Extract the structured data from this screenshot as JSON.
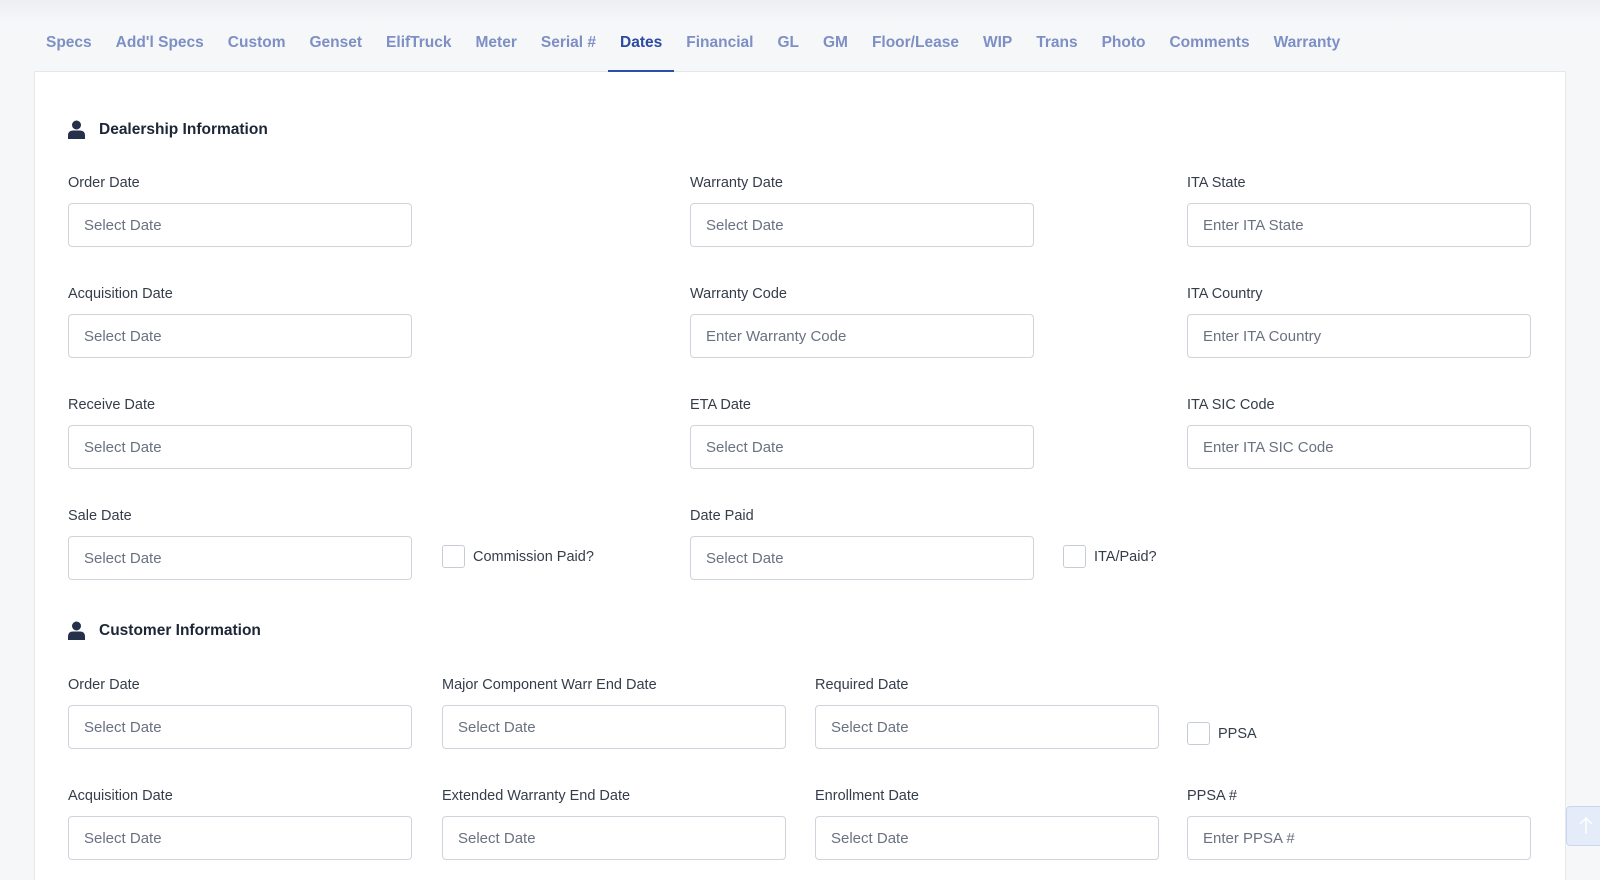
{
  "tabs": [
    {
      "label": "Specs"
    },
    {
      "label": "Add'l Specs"
    },
    {
      "label": "Custom"
    },
    {
      "label": "Genset"
    },
    {
      "label": "ElifTruck"
    },
    {
      "label": "Meter"
    },
    {
      "label": "Serial #"
    },
    {
      "label": "Dates"
    },
    {
      "label": "Financial"
    },
    {
      "label": "GL"
    },
    {
      "label": "GM"
    },
    {
      "label": "Floor/Lease"
    },
    {
      "label": "WIP"
    },
    {
      "label": "Trans"
    },
    {
      "label": "Photo"
    },
    {
      "label": "Comments"
    },
    {
      "label": "Warranty"
    }
  ],
  "active_tab": "Dates",
  "dealership": {
    "title": "Dealership Information",
    "order_date": {
      "label": "Order Date",
      "placeholder": "Select Date"
    },
    "acquisition_date": {
      "label": "Acquisition Date",
      "placeholder": "Select Date"
    },
    "receive_date": {
      "label": "Receive Date",
      "placeholder": "Select Date"
    },
    "sale_date": {
      "label": "Sale Date",
      "placeholder": "Select Date"
    },
    "commission_paid": {
      "label": "Commission Paid?",
      "checked": false
    },
    "warranty_date": {
      "label": "Warranty Date",
      "placeholder": "Select Date"
    },
    "warranty_code": {
      "label": "Warranty Code",
      "placeholder": "Enter Warranty Code"
    },
    "eta_date": {
      "label": "ETA Date",
      "placeholder": "Select Date"
    },
    "date_paid": {
      "label": "Date Paid",
      "placeholder": "Select Date"
    },
    "ita_paid": {
      "label": "ITA/Paid?",
      "checked": false
    },
    "ita_state": {
      "label": "ITA State",
      "placeholder": "Enter ITA State"
    },
    "ita_country": {
      "label": "ITA Country",
      "placeholder": "Enter ITA Country"
    },
    "ita_sic_code": {
      "label": "ITA SIC Code",
      "placeholder": "Enter ITA SIC Code"
    }
  },
  "customer": {
    "title": "Customer Information",
    "order_date": {
      "label": "Order Date",
      "placeholder": "Select Date"
    },
    "acquisition_date": {
      "label": "Acquisition Date",
      "placeholder": "Select Date"
    },
    "major_component_warr_end": {
      "label": "Major Component Warr End Date",
      "placeholder": "Select Date"
    },
    "extended_warranty_end": {
      "label": "Extended Warranty End Date",
      "placeholder": "Select Date"
    },
    "required_date": {
      "label": "Required Date",
      "placeholder": "Select Date"
    },
    "enrollment_date": {
      "label": "Enrollment Date",
      "placeholder": "Select Date"
    },
    "ppsa": {
      "label": "PPSA",
      "checked": false
    },
    "ppsa_number": {
      "label": "PPSA #",
      "placeholder": "Enter PPSA #"
    }
  },
  "icons": {
    "section": "user-icon",
    "scroll_top": "arrow-up-icon"
  },
  "colors": {
    "accent": "#2c4ea8",
    "tab_inactive": "#7d8fc5"
  }
}
